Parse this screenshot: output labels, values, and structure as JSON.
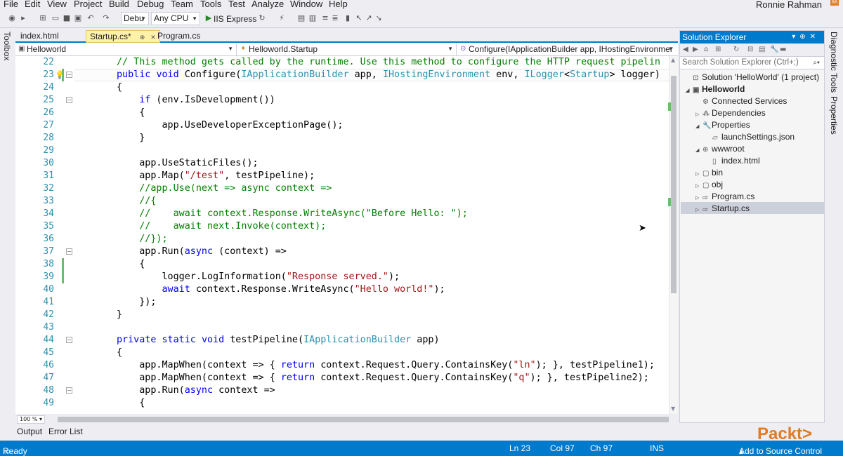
{
  "menu": [
    "File",
    "Edit",
    "View",
    "Project",
    "Build",
    "Debug",
    "Team",
    "Tools",
    "Test",
    "Analyze",
    "Window",
    "Help"
  ],
  "user": {
    "name": "Ronnie Rahman",
    "avatar": "RR"
  },
  "toolbar": {
    "config": "Debu",
    "platform": "Any CPU",
    "run_target": "IIS Express",
    "icons": [
      "back-icon",
      "forward-icon",
      "new-project-icon",
      "open-icon",
      "save-icon",
      "save-all-icon",
      "undo-icon",
      "redo-icon",
      "play-icon",
      "refresh-icon"
    ]
  },
  "side_rails": {
    "left": "Toolbox",
    "right": [
      "Diagnostic Tools",
      "Properties"
    ]
  },
  "tabs": [
    {
      "label": "index.html",
      "active": false
    },
    {
      "label": "Startup.cs*",
      "active": true
    },
    {
      "label": "Program.cs",
      "active": false
    }
  ],
  "nav": {
    "project": "Helloworld",
    "class": "Helloworld.Startup",
    "member": "Configure(IApplicationBuilder app, IHostingEnvironmer"
  },
  "editor": {
    "line_numbers": [
      "22",
      "23",
      "24",
      "25",
      "26",
      "27",
      "28",
      "29",
      "30",
      "31",
      "32",
      "33",
      "34",
      "35",
      "36",
      "37",
      "38",
      "39",
      "40",
      "41",
      "42",
      "43",
      "44",
      "45",
      "46",
      "47",
      "48",
      "49"
    ],
    "lines": [
      [
        {
          "t": "// This method gets called by the runtime. Use this method to configure the HTTP request pipelin",
          "c": "cm"
        }
      ],
      [
        {
          "t": "public",
          "c": "kw"
        },
        {
          "t": " "
        },
        {
          "t": "void",
          "c": "kw"
        },
        {
          "t": " Configure("
        },
        {
          "t": "IApplicationBuilder",
          "c": "ty"
        },
        {
          "t": " app, "
        },
        {
          "t": "IHostingEnvironment",
          "c": "ty"
        },
        {
          "t": " env, "
        },
        {
          "t": "ILogger",
          "c": "ty"
        },
        {
          "t": "<"
        },
        {
          "t": "Startup",
          "c": "ty"
        },
        {
          "t": "> logger)"
        }
      ],
      [
        {
          "t": "{"
        }
      ],
      [
        {
          "t": "    "
        },
        {
          "t": "if",
          "c": "kw"
        },
        {
          "t": " (env.IsDevelopment())"
        }
      ],
      [
        {
          "t": "    {"
        }
      ],
      [
        {
          "t": "        app.UseDeveloperExceptionPage();"
        }
      ],
      [
        {
          "t": "    }"
        }
      ],
      [
        {
          "t": ""
        }
      ],
      [
        {
          "t": "    app.UseStaticFiles();"
        }
      ],
      [
        {
          "t": "    app.Map("
        },
        {
          "t": "\"/test\"",
          "c": "st"
        },
        {
          "t": ", testPipeline);"
        }
      ],
      [
        {
          "t": "    //app.Use(next => async context =>",
          "c": "cm"
        }
      ],
      [
        {
          "t": "    //{",
          "c": "cm"
        }
      ],
      [
        {
          "t": "    //    await context.Response.WriteAsync(\"Before Hello: \");",
          "c": "cm"
        }
      ],
      [
        {
          "t": "    //    await next.Invoke(context);",
          "c": "cm"
        }
      ],
      [
        {
          "t": "    //});",
          "c": "cm"
        }
      ],
      [
        {
          "t": "    app.Run("
        },
        {
          "t": "async",
          "c": "kw"
        },
        {
          "t": " (context) =>"
        }
      ],
      [
        {
          "t": "    {"
        }
      ],
      [
        {
          "t": "        logger.LogInformation("
        },
        {
          "t": "\"Response served.\"",
          "c": "st"
        },
        {
          "t": ");"
        }
      ],
      [
        {
          "t": "        "
        },
        {
          "t": "await",
          "c": "kw"
        },
        {
          "t": " context.Response.WriteAsync("
        },
        {
          "t": "\"Hello world!\"",
          "c": "st"
        },
        {
          "t": ");"
        }
      ],
      [
        {
          "t": "    });"
        }
      ],
      [
        {
          "t": "}"
        }
      ],
      [
        {
          "t": ""
        }
      ],
      [
        {
          "t": "private",
          "c": "kw"
        },
        {
          "t": " "
        },
        {
          "t": "static",
          "c": "kw"
        },
        {
          "t": " "
        },
        {
          "t": "void",
          "c": "kw"
        },
        {
          "t": " testPipeline("
        },
        {
          "t": "IApplicationBuilder",
          "c": "ty"
        },
        {
          "t": " app)"
        }
      ],
      [
        {
          "t": "{"
        }
      ],
      [
        {
          "t": "    app.MapWhen(context => { "
        },
        {
          "t": "return",
          "c": "kw"
        },
        {
          "t": " context.Request.Query.ContainsKey("
        },
        {
          "t": "\"ln\"",
          "c": "st"
        },
        {
          "t": "); }, testPipeline1);"
        }
      ],
      [
        {
          "t": "    app.MapWhen(context => { "
        },
        {
          "t": "return",
          "c": "kw"
        },
        {
          "t": " context.Request.Query.ContainsKey("
        },
        {
          "t": "\"q\"",
          "c": "st"
        },
        {
          "t": "); }, testPipeline2);"
        }
      ],
      [
        {
          "t": "    app.Run("
        },
        {
          "t": "async",
          "c": "kw"
        },
        {
          "t": " context =>"
        }
      ],
      [
        {
          "t": "    {"
        }
      ]
    ],
    "zoom": "100 %"
  },
  "solution_explorer": {
    "title": "Solution Explorer",
    "search_placeholder": "Search Solution Explorer (Ctrl+;)",
    "items": [
      {
        "label": "Solution 'HelloWorld' (1 project)",
        "icon": "solution-icon"
      },
      {
        "label": "Helloworld",
        "icon": "project-icon"
      },
      {
        "label": "Connected Services",
        "icon": "connected-services-icon"
      },
      {
        "label": "Dependencies",
        "icon": "dependencies-icon"
      },
      {
        "label": "Properties",
        "icon": "wrench-icon"
      },
      {
        "label": "launchSettings.json",
        "icon": "json-file-icon"
      },
      {
        "label": "wwwroot",
        "icon": "globe-icon"
      },
      {
        "label": "index.html",
        "icon": "html-file-icon"
      },
      {
        "label": "bin",
        "icon": "folder-icon"
      },
      {
        "label": "obj",
        "icon": "folder-icon"
      },
      {
        "label": "Program.cs",
        "icon": "csharp-file-icon"
      },
      {
        "label": "Startup.cs",
        "icon": "csharp-file-icon"
      }
    ]
  },
  "bottom_tabs": [
    "Output",
    "Error List"
  ],
  "status": {
    "ready": "Ready",
    "ln": "Ln 23",
    "col": "Col 97",
    "ch": "Ch 97",
    "mode": "INS",
    "source_control": "Add to Source Control"
  },
  "watermark": "Packt>",
  "colors": {
    "accent": "#007acc",
    "keyword": "#0000ff",
    "type": "#2b91af",
    "comment": "#008000",
    "string": "#a31515",
    "watermark": "#e07c26"
  }
}
